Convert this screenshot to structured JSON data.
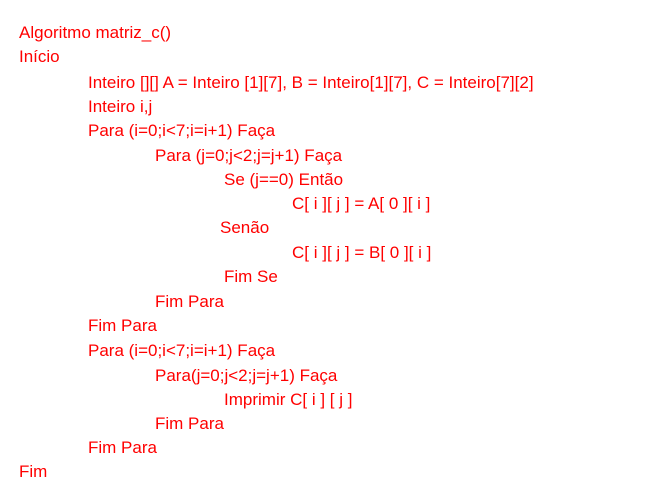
{
  "text_color": "#ff0000",
  "pseudocode": {
    "l01": "Algoritmo matriz_c()",
    "l02": "Início",
    "l03": "Inteiro [][] A = Inteiro [1][7], B = Inteiro[1][7], C = Inteiro[7][2]",
    "l04": "Inteiro i,j",
    "l05": "Para (i=0;i<7;i=i+1) Faça",
    "l06": "Para (j=0;j<2;j=j+1) Faça",
    "l07": "Se (j==0) Então",
    "l08": "C[ i ][ j ] = A[ 0 ][ i ]",
    "l09": "Senão",
    "l10": "C[ i ][ j ] = B[ 0 ][ i ]",
    "l11": "Fim Se",
    "l12": "Fim Para",
    "l13": "Fim Para",
    "l14": "Para (i=0;i<7;i=i+1) Faça",
    "l15": "Para(j=0;j<2;j=j+1) Faça",
    "l16": "Imprimir C[ i ] [ j ]",
    "l17": "Fim Para",
    "l18": "Fim Para",
    "l19": "Fim"
  }
}
